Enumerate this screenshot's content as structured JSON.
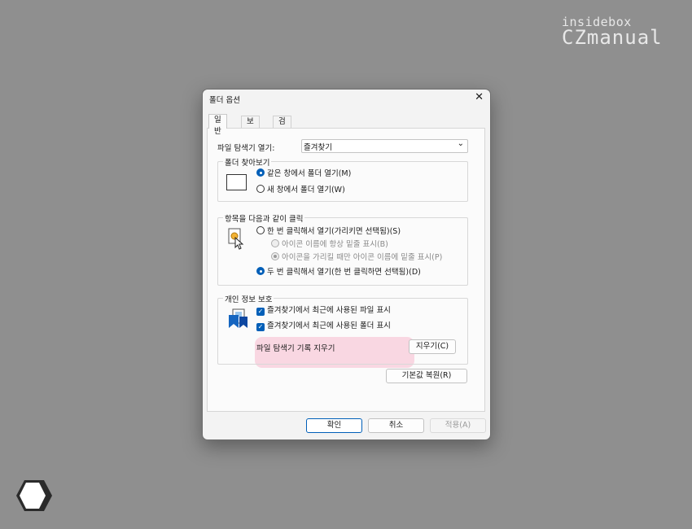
{
  "watermark": {
    "line1": "insidebox",
    "line2": "CZmanual"
  },
  "dialog": {
    "title": "폴더 옵션",
    "close_glyph": "✕",
    "tabs": [
      {
        "label": "일반",
        "active": true
      },
      {
        "label": "보기",
        "active": false
      },
      {
        "label": "검색",
        "active": false
      }
    ],
    "open_explorer": {
      "label": "파일 탐색기 열기:",
      "value": "즐겨찾기",
      "chevron": "⌄"
    },
    "browse_folders": {
      "title": "폴더 찾아보기",
      "options": [
        {
          "label": "같은 창에서 폴더 열기(M)",
          "selected": true
        },
        {
          "label": "새 창에서 폴더 열기(W)",
          "selected": false
        }
      ]
    },
    "click_items": {
      "title": "항목을 다음과 같이 클릭",
      "single_click": "한 번 클릭해서 열기(가리키면 선택됨)(S)",
      "sub_options": [
        {
          "label": "아이콘 이름에 항상 밑줄 표시(B)",
          "selected": false
        },
        {
          "label": "아이콘을 가리킬 때만 아이콘 이름에 밑줄 표시(P)",
          "selected": true
        }
      ],
      "double_click": "두 번 클릭해서 열기(한 번 클릭하면 선택됨)(D)"
    },
    "privacy": {
      "title": "개인 정보 보호",
      "checks": [
        {
          "label": "즐겨찾기에서 최근에 사용된 파일 표시",
          "checked": true
        },
        {
          "label": "즐겨찾기에서 최근에 사용된 폴더 표시",
          "checked": true
        }
      ],
      "clear_label": "파일 탐색기 기록 지우기",
      "clear_button": "지우기(C)"
    },
    "restore_defaults": "기본값 복원(R)",
    "buttons": {
      "ok": "확인",
      "cancel": "취소",
      "apply": "적용(A)"
    },
    "colors": {
      "accent": "#005fb8",
      "highlight": "#f9d7e2",
      "background": "#8f8f8f"
    }
  }
}
